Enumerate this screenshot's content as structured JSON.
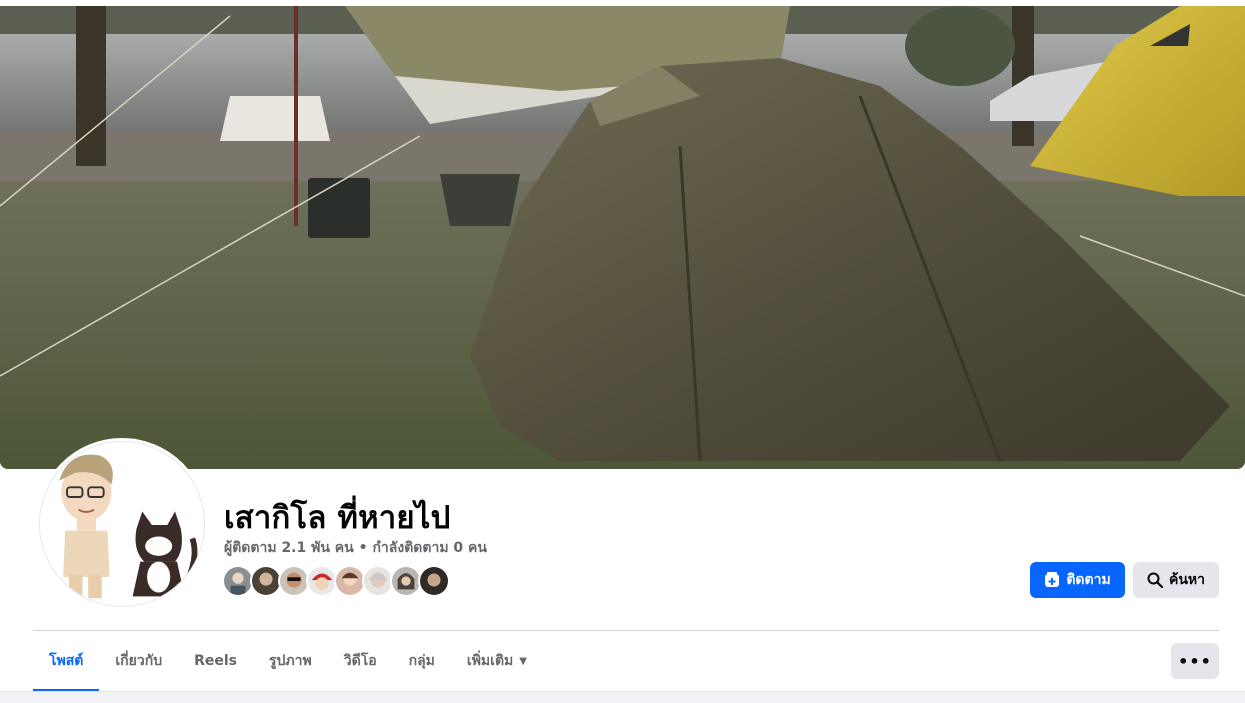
{
  "profile": {
    "name": "เสากิโล ที่หายไป",
    "followers_text": "ผู้ติดตาม 2.1 พัน คน",
    "separator": "•",
    "following_text": "กำลังติดตาม 0 คน"
  },
  "buttons": {
    "follow_label": "ติดตาม",
    "search_label": "ค้นหา",
    "more_label": "•••"
  },
  "tabs": [
    {
      "label": "โพสต์",
      "active": true
    },
    {
      "label": "เกี่ยวกับ",
      "active": false
    },
    {
      "label": "Reels",
      "active": false
    },
    {
      "label": "รูปภาพ",
      "active": false
    },
    {
      "label": "วิดีโอ",
      "active": false
    },
    {
      "label": "กลุ่ม",
      "active": false
    },
    {
      "label": "เพิ่มเติม",
      "active": false
    }
  ],
  "colors": {
    "accent": "#0866ff",
    "secondary_button": "#e4e6eb",
    "muted_text": "#65676b"
  },
  "icons": {
    "follow": "follow-plus-icon",
    "search": "search-icon",
    "more_tab": "caret-down-icon",
    "more_button": "ellipsis-icon"
  }
}
